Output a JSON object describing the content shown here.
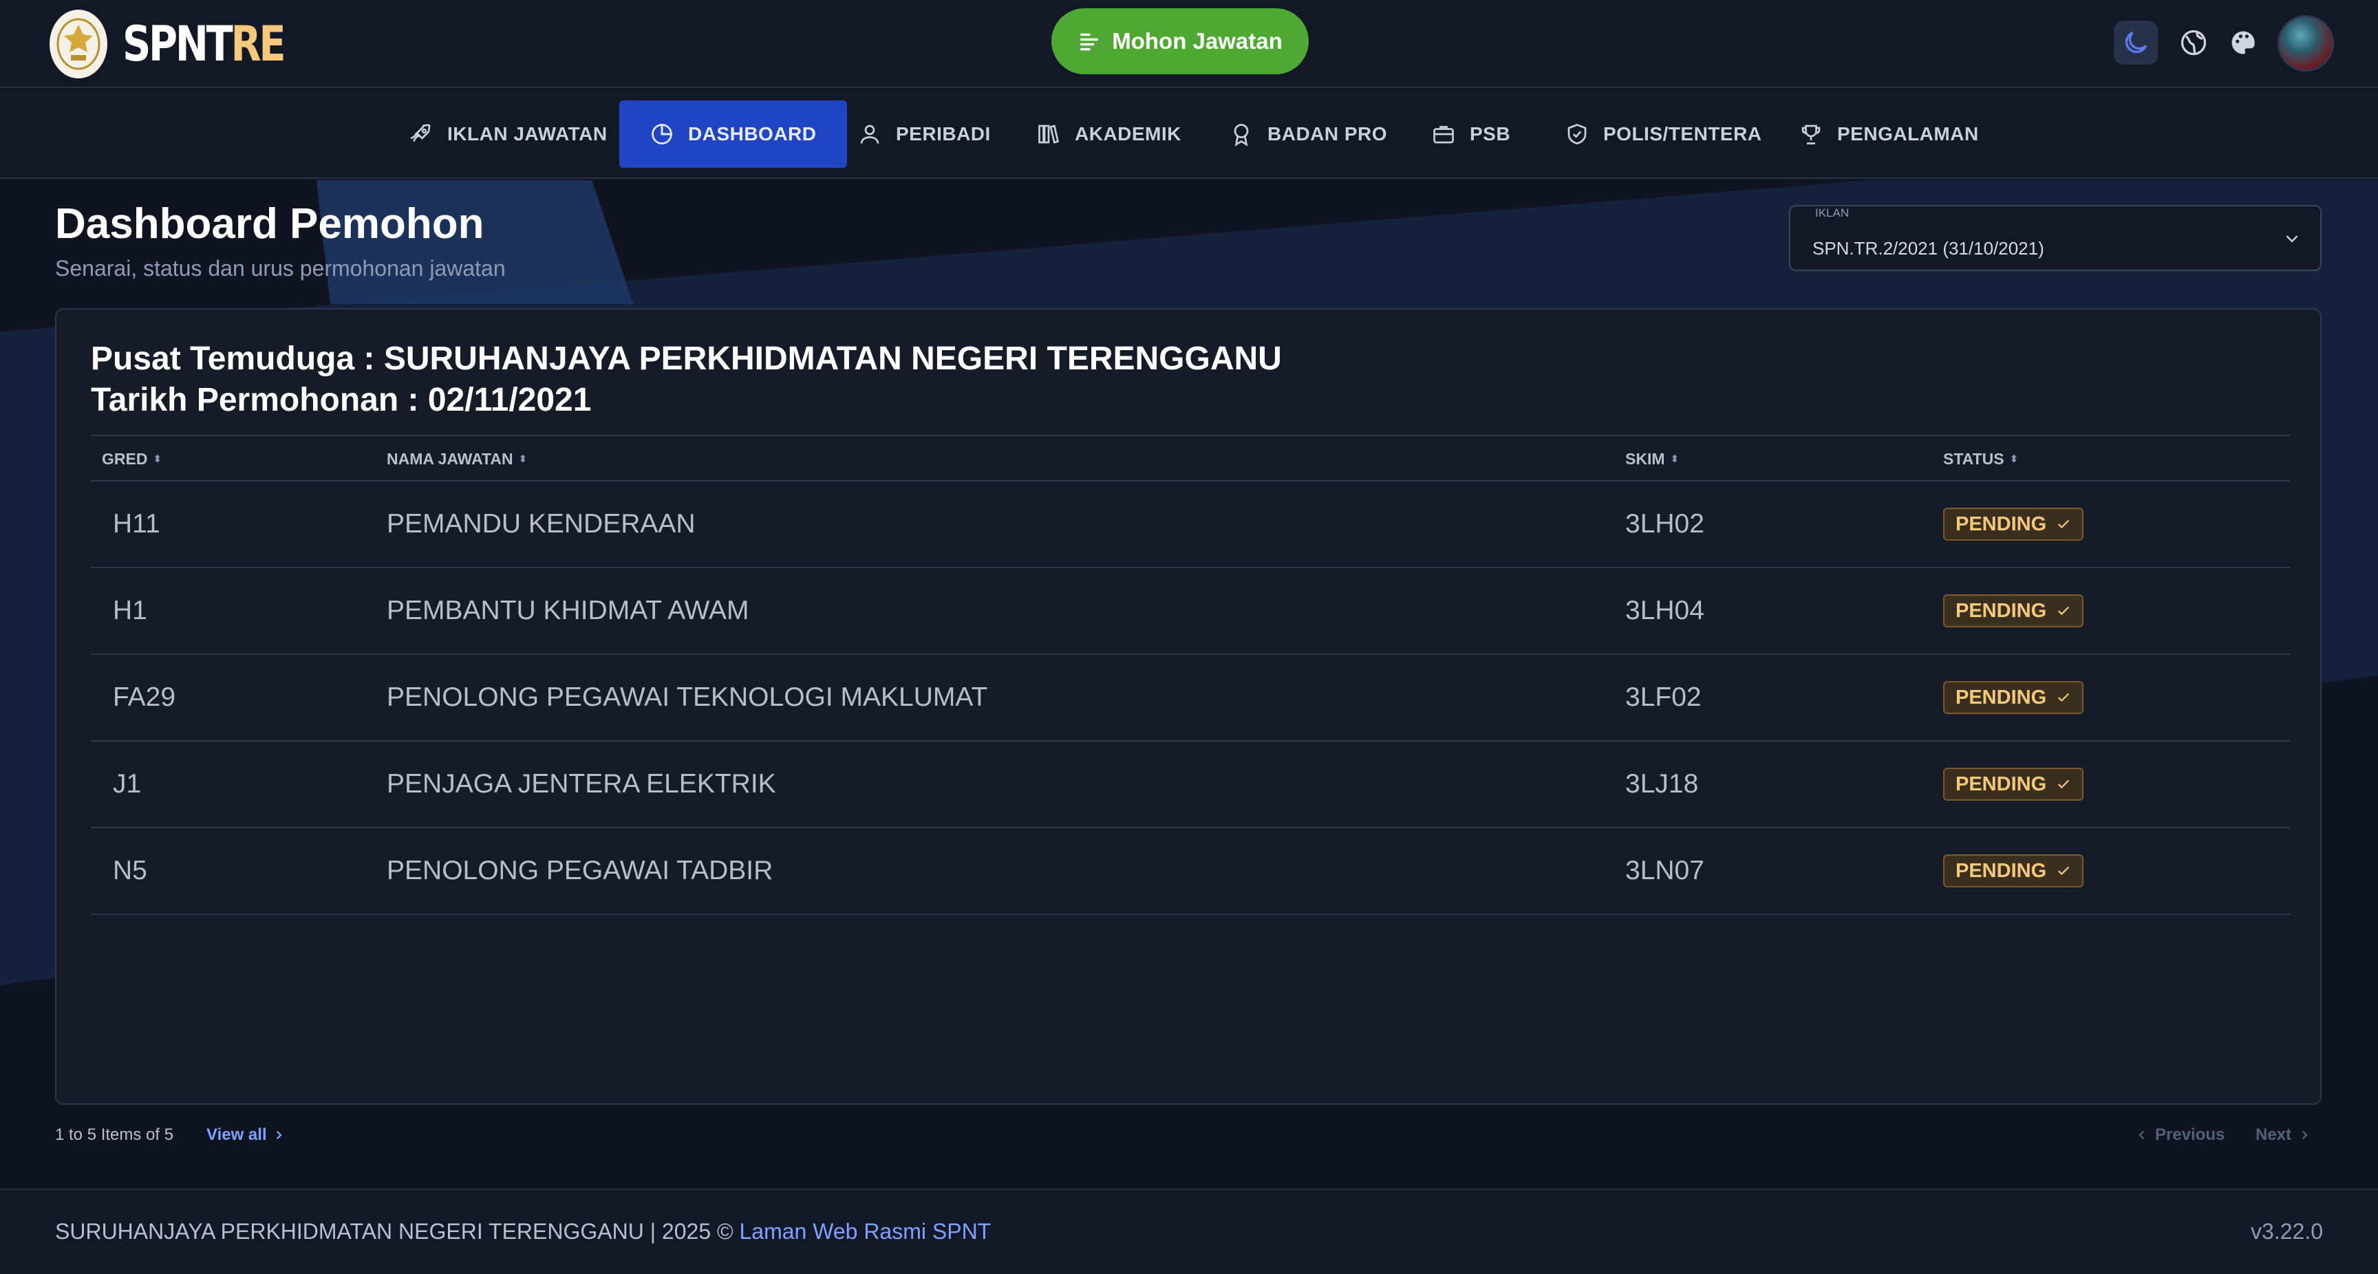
{
  "brand": {
    "name_part1": "SPNT",
    "name_part2": "RE"
  },
  "header": {
    "apply_label": "Mohon Jawatan",
    "icons": [
      "moon-icon",
      "globe-icon",
      "palette-icon",
      "avatar"
    ]
  },
  "nav": {
    "items": [
      {
        "label": "IKLAN JAWATAN",
        "icon": "rocket-icon"
      },
      {
        "label": "DASHBOARD",
        "icon": "pie-chart-icon",
        "active": true
      },
      {
        "label": "PERIBADI",
        "icon": "user-icon"
      },
      {
        "label": "AKADEMIK",
        "icon": "books-icon"
      },
      {
        "label": "BADAN PRO",
        "icon": "award-icon"
      },
      {
        "label": "PSB",
        "icon": "briefcase-icon"
      },
      {
        "label": "POLIS/TENTERA",
        "icon": "shield-icon"
      },
      {
        "label": "PENGALAMAN",
        "icon": "trophy-icon"
      }
    ]
  },
  "page": {
    "title": "Dashboard Pemohon",
    "subtitle": "Senarai, status dan urus permohonan jawatan"
  },
  "iklan_select": {
    "label": "IKLAN",
    "value": "SPN.TR.2/2021 (31/10/2021)"
  },
  "card": {
    "line1": "Pusat Temuduga : SURUHANJAYA PERKHIDMATAN NEGERI TERENGGANU",
    "line2": "Tarikh Permohonan : 02/11/2021"
  },
  "table": {
    "headers": [
      "GRED",
      "NAMA JAWATAN",
      "SKIM",
      "STATUS"
    ],
    "rows": [
      {
        "gred": "H11",
        "nama": "PEMANDU KENDERAAN",
        "skim": "3LH02",
        "status": "PENDING"
      },
      {
        "gred": "H1",
        "nama": "PEMBANTU KHIDMAT AWAM",
        "skim": "3LH04",
        "status": "PENDING"
      },
      {
        "gred": "FA29",
        "nama": "PENOLONG PEGAWAI TEKNOLOGI MAKLUMAT",
        "skim": "3LF02",
        "status": "PENDING"
      },
      {
        "gred": "J1",
        "nama": "PENJAGA JENTERA ELEKTRIK",
        "skim": "3LJ18",
        "status": "PENDING"
      },
      {
        "gred": "N5",
        "nama": "PENOLONG PEGAWAI TADBIR",
        "skim": "3LN07",
        "status": "PENDING"
      }
    ]
  },
  "pagination": {
    "info": "1 to 5 Items of 5",
    "view_all": "View all",
    "previous": "Previous",
    "next": "Next"
  },
  "footer": {
    "text": "SURUHANJAYA PERKHIDMATAN NEGERI TERENGGANU |  2025 © ",
    "link": "Laman Web Rasmi SPNT",
    "version": "v3.22.0"
  },
  "colors": {
    "accent_green": "#4ea833",
    "nav_active": "#1f44c4",
    "pending_text": "#f6c97a",
    "link": "#7ea2ff",
    "background": "#0f1420"
  }
}
